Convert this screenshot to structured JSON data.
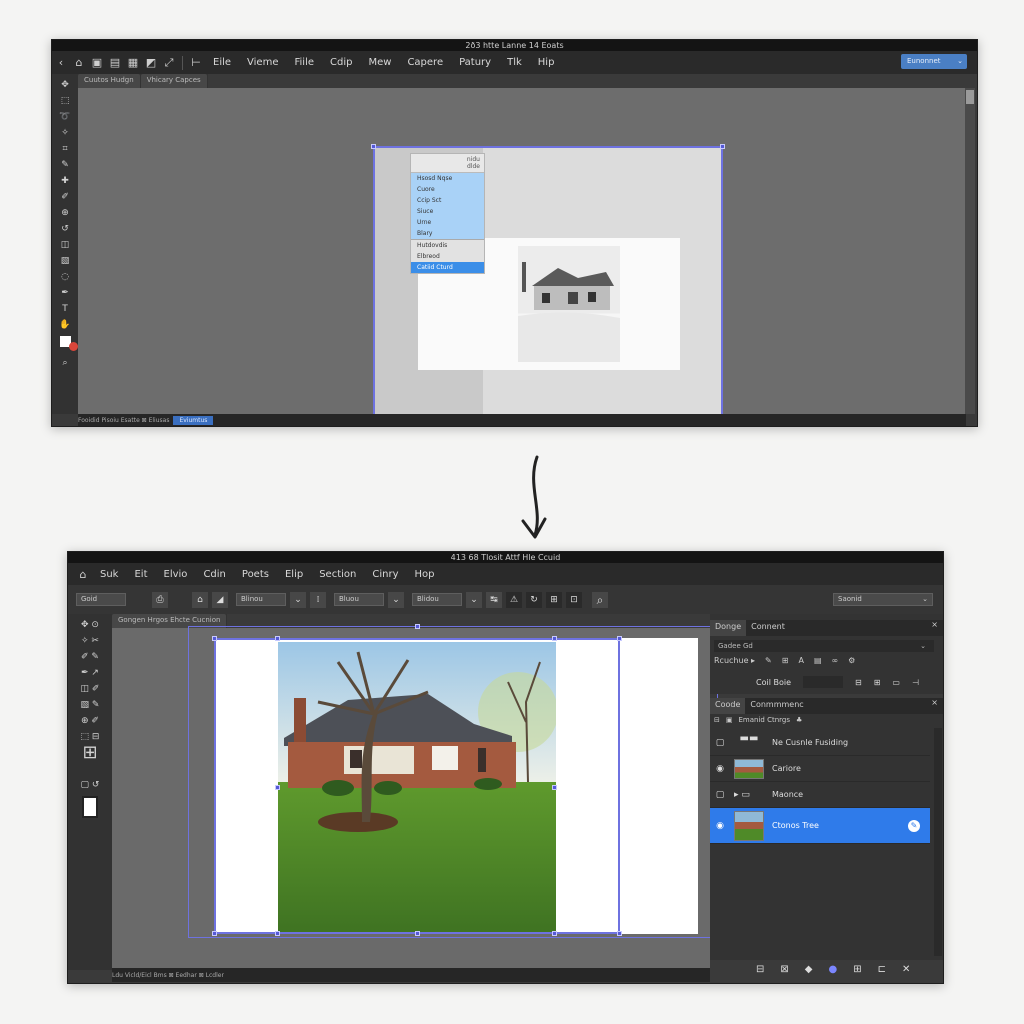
{
  "window1": {
    "title": "2ð3 htte Lanne 14 Eoats",
    "menu": [
      "Eile",
      "Vieme",
      "Fiile",
      "Cdip",
      "Mew",
      "Capere",
      "Patury",
      "Tlk",
      "Hip"
    ],
    "primary_button": "Eunonnet",
    "tabs": [
      "Cuutos Hudgn",
      "Vhicary Capces"
    ],
    "context_menu": {
      "header": [
        "nidu",
        "dlde"
      ],
      "options": [
        "Hsosd Nqse",
        "Cuore",
        "Ccip Sct",
        "Siuce",
        "Urne",
        "Blary",
        "Hutdovdis",
        "Elbreod",
        "Catiid Cturd"
      ]
    },
    "status": "Fooidid Pisoiu Esatte  ⊠ Eliusas",
    "status_chip": "Eviumtus"
  },
  "window2": {
    "title": "413 68 Tlosit Attf Hle Ccuid",
    "menu": [
      "Suk",
      "Eit",
      "Elvio",
      "Cdin",
      "Poets",
      "Elip",
      "Section",
      "Cinry",
      "Hop"
    ],
    "options": {
      "field1": "Goid",
      "field2": "Blinou",
      "field3": "Bluou",
      "field4": "Blidou"
    },
    "options_right_field": "Saonid",
    "tab": "Gongen Hrgos Ehcte Cucnion",
    "status": "Ldu Vicld/Eicl  Bms  ⊠ Eedhar  ⊠ Lcdler",
    "panel1": {
      "tabs": [
        "Donge",
        "Connent"
      ],
      "row1": "Gadee Gd",
      "row2": "Rcuchue ▸",
      "row3": "Coil Boie"
    },
    "panel2": {
      "tabs": [
        "Coode",
        "Conmmmenc"
      ],
      "filter": "Emanid Ctnrgs",
      "layers": [
        "Ne Cusnle Fusiding",
        "Cariore",
        "Maonce",
        "Ctonos Tree"
      ]
    }
  },
  "colors": {
    "accent": "#2f7bea",
    "selection": "#6e72e0",
    "window_bg": "#3a3a3a"
  }
}
